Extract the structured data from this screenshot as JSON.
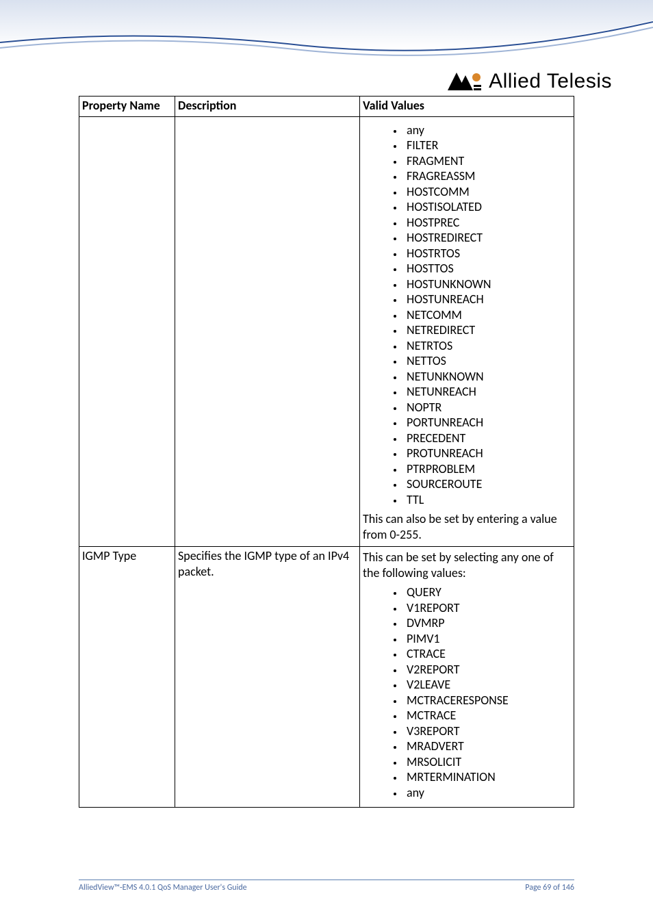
{
  "logo_text": "Allied Telesis",
  "table": {
    "headers": {
      "property_name": "Property Name",
      "description": "Description",
      "valid_values": "Valid Values"
    },
    "row1": {
      "property_name": "",
      "description": "",
      "values": [
        "any",
        "FILTER",
        "FRAGMENT",
        "FRAGREASSM",
        "HOSTCOMM",
        "HOSTISOLATED",
        "HOSTPREC",
        "HOSTREDIRECT",
        "HOSTRTOS",
        "HOSTTOS",
        "HOSTUNKNOWN",
        "HOSTUNREACH",
        "NETCOMM",
        "NETREDIRECT",
        "NETRTOS",
        "NETTOS",
        "NETUNKNOWN",
        "NETUNREACH",
        "NOPTR",
        "PORTUNREACH",
        "PRECEDENT",
        "PROTUNREACH",
        "PTRPROBLEM",
        "SOURCEROUTE",
        "TTL"
      ],
      "trailer": "This can also be set by entering a value from 0-255."
    },
    "row2": {
      "property_name": "IGMP Type",
      "description": "Specifies the IGMP type of an IPv4 packet.",
      "intro": "This can be set by selecting any one of the following values:",
      "values": [
        "QUERY",
        "V1REPORT",
        "DVMRP",
        "PIMV1",
        "CTRACE",
        "V2REPORT",
        "V2LEAVE",
        "MCTRACERESPONSE",
        "MCTRACE",
        "V3REPORT",
        "MRADVERT",
        "MRSOLICIT",
        "MRTERMINATION",
        "any"
      ]
    }
  },
  "footer": {
    "left": "AlliedView™-EMS 4.0.1 QoS Manager User's Guide",
    "right": "Page 69 of 146"
  }
}
